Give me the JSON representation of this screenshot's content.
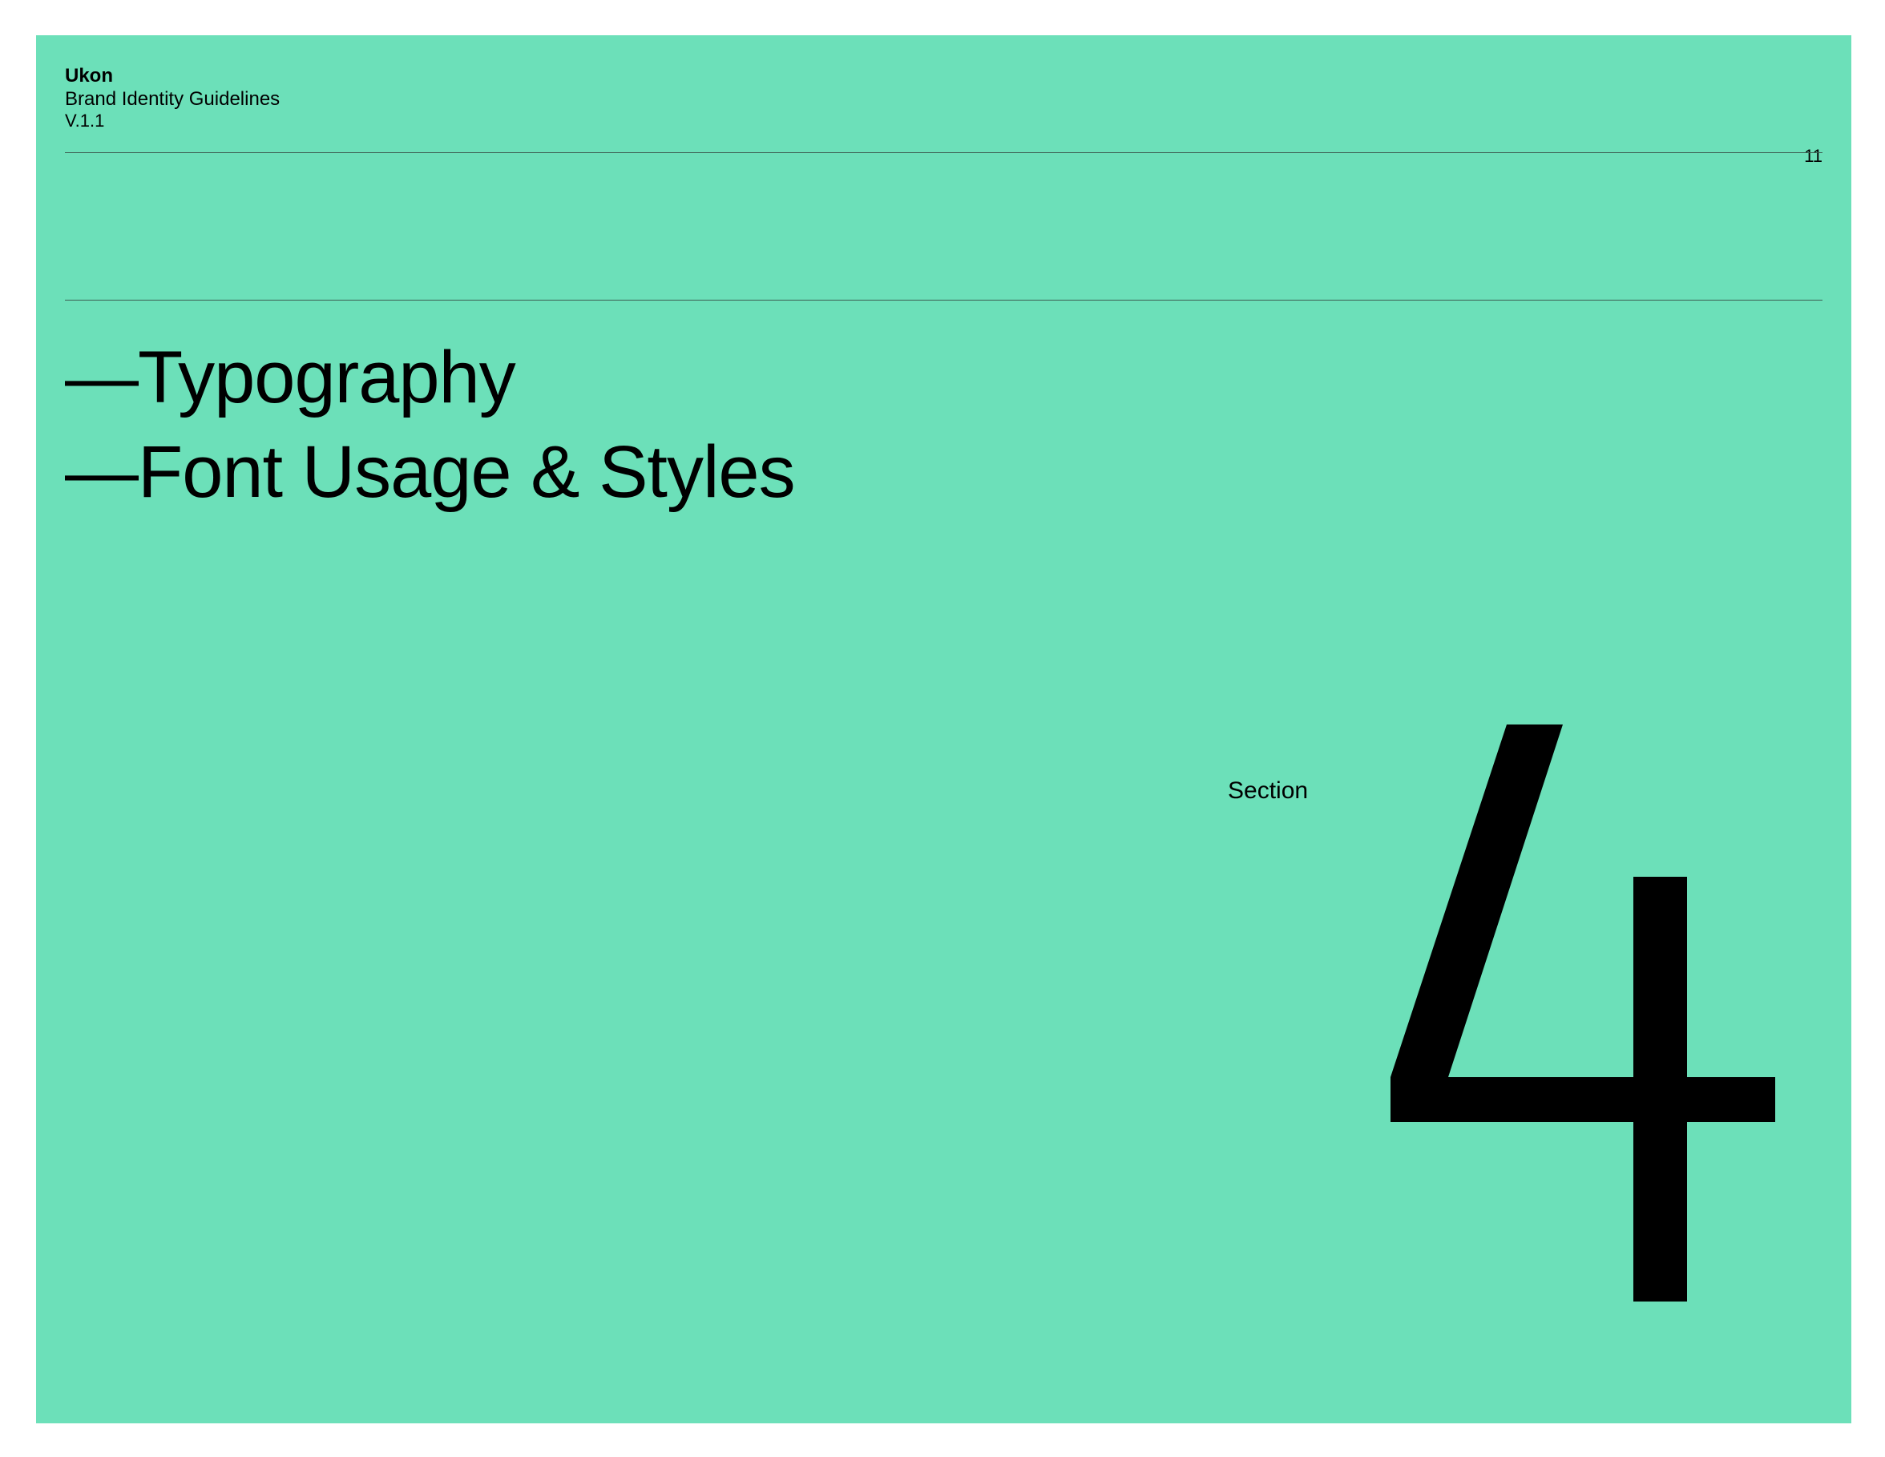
{
  "header": {
    "brand_name": "Ukon",
    "subtitle": "Brand Identity Guidelines",
    "version": "V.1.1",
    "page_number": "11"
  },
  "main": {
    "headings": [
      {
        "label": "—Typography"
      },
      {
        "label": "—Font Usage & Styles"
      }
    ],
    "section_label": "Section",
    "section_number": "4"
  },
  "colors": {
    "background": "#6ce0b9",
    "text": "#000000",
    "rule": "#3d5e52"
  }
}
